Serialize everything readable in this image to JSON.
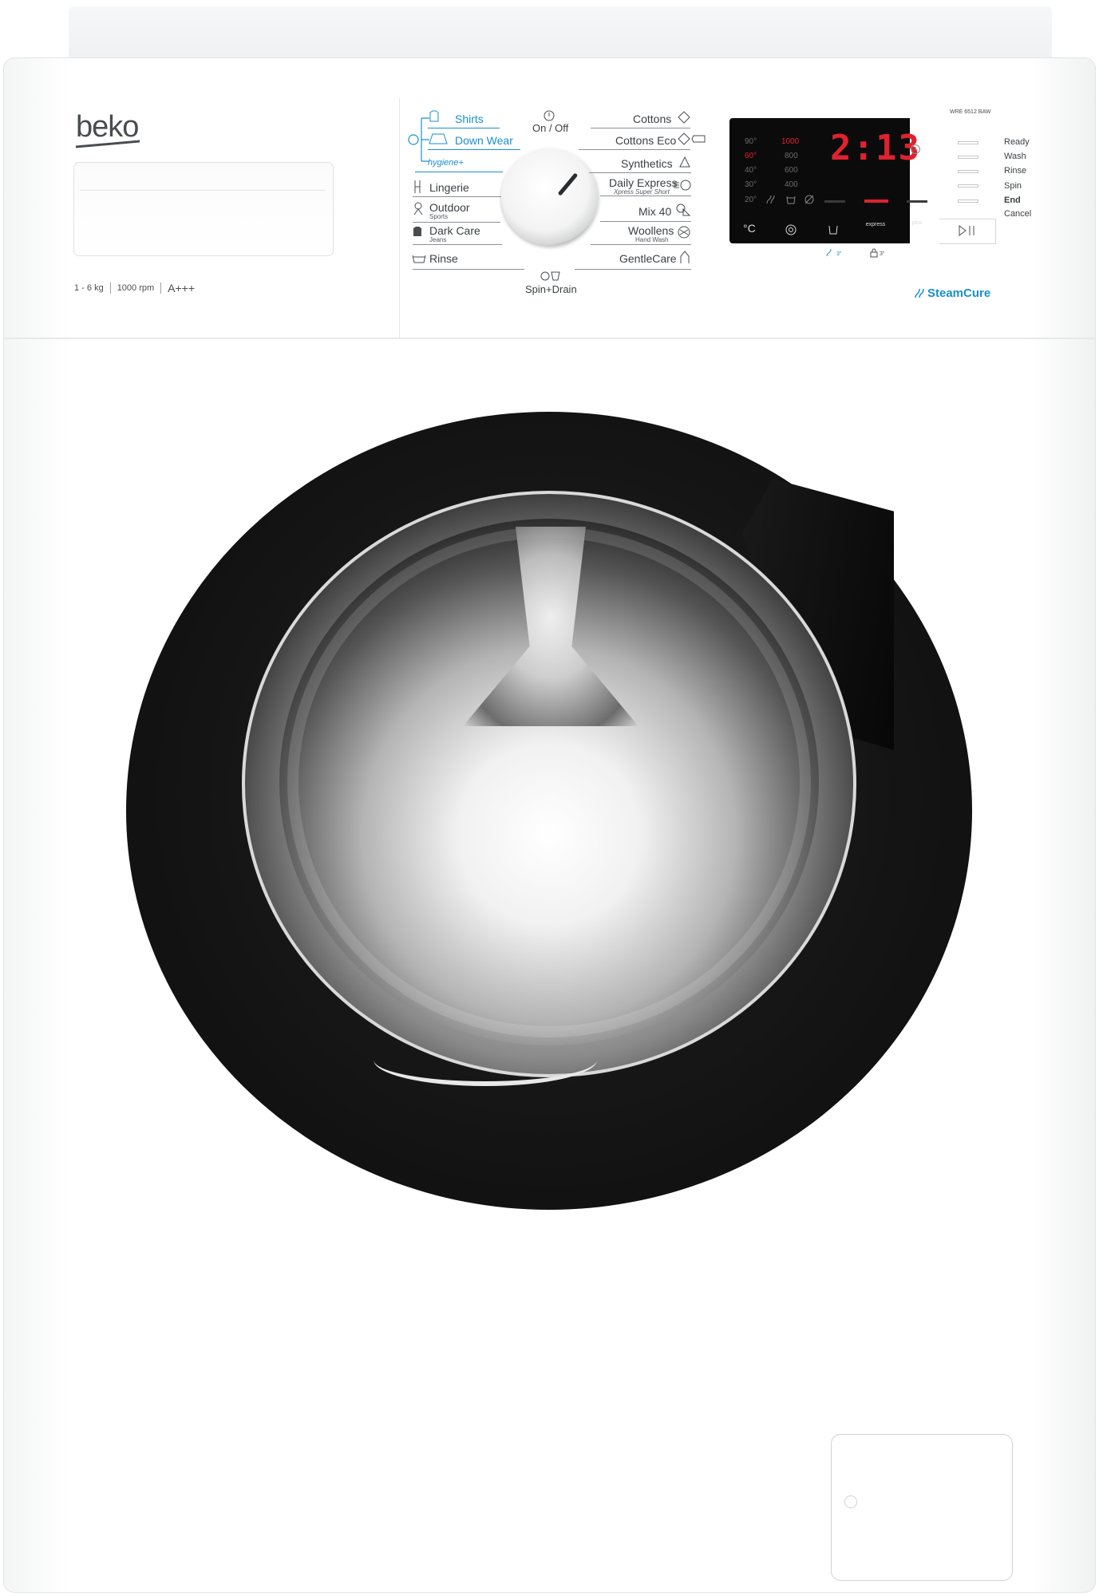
{
  "brand": {
    "name": "beko"
  },
  "specs": {
    "capacity": "1 - 6 kg",
    "rpm": "1000 rpm",
    "energy": "A+++"
  },
  "model": "WRE 6512 BAW",
  "feature_logo": "SteamCure",
  "dial": {
    "on_off": "On / Off",
    "spin_drain": "Spin+Drain"
  },
  "programs_left": [
    {
      "label": "Shirts"
    },
    {
      "label": "Down Wear"
    },
    {
      "label": "hygiene+"
    },
    {
      "label": "Lingerie"
    },
    {
      "label": "Outdoor",
      "sub": "Sports"
    },
    {
      "label": "Dark Care",
      "sub": "Jeans"
    },
    {
      "label": "Rinse"
    }
  ],
  "programs_right": [
    {
      "label": "Cottons"
    },
    {
      "label": "Cottons Eco"
    },
    {
      "label": "Synthetics"
    },
    {
      "label": "Daily Express",
      "sub": "Xpress Super Short"
    },
    {
      "label": "Mix 40"
    },
    {
      "label": "Woollens",
      "sub": "Hand Wash"
    },
    {
      "label": "GentleCare"
    }
  ],
  "display": {
    "temps": [
      "90°",
      "60°",
      "40°",
      "30°",
      "20°"
    ],
    "speeds": [
      "1000",
      "800",
      "600",
      "400"
    ],
    "time": "2:13",
    "buttons": [
      "°C",
      "spin",
      "soil",
      "express",
      "plus"
    ],
    "button_labels": {
      "express": "express",
      "plus": "plus"
    }
  },
  "status_steps": [
    "Ready",
    "Wash",
    "Rinse",
    "Spin",
    "End",
    "Cancel"
  ],
  "sub_icons": {
    "child_lock": "3\"",
    "steam": "3\""
  },
  "colors": {
    "accent_blue": "#1a8fd0",
    "display_red": "#e0222e",
    "body_white": "#ffffff",
    "door_black": "#111111"
  }
}
